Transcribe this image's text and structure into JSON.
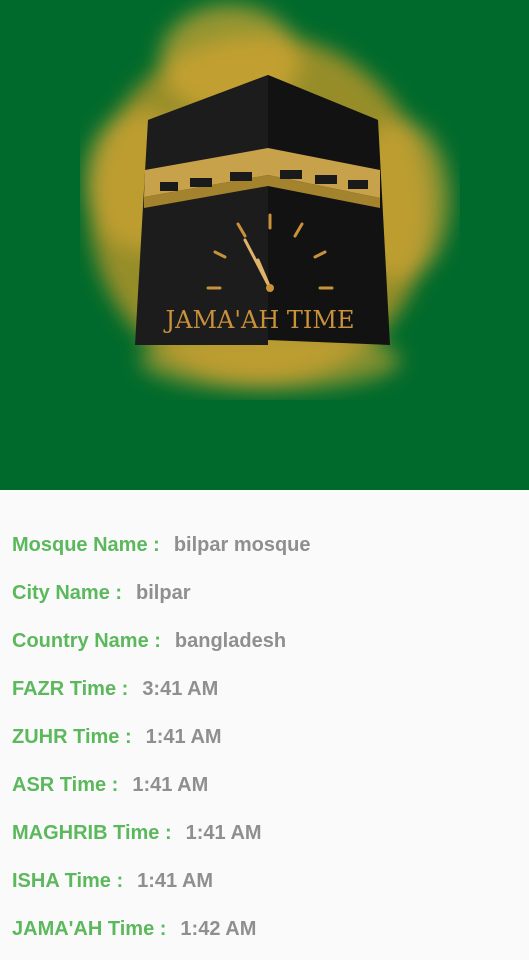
{
  "logo": {
    "text": "JAMA'AH TIME",
    "colors": {
      "background": "#006a2c",
      "glow": "#d8a52a",
      "cube": "#1a1a1a",
      "band": "#c8a24a",
      "logo_text": "#c9913a"
    }
  },
  "info": {
    "rows": [
      {
        "label": "Mosque Name :",
        "value": "bilpar mosque"
      },
      {
        "label": "City Name :",
        "value": "bilpar"
      },
      {
        "label": "Country Name :",
        "value": "bangladesh"
      },
      {
        "label": "FAZR Time :",
        "value": "3:41 AM"
      },
      {
        "label": "ZUHR Time :",
        "value": "1:41 AM"
      },
      {
        "label": "ASR Time :",
        "value": "1:41 AM"
      },
      {
        "label": "MAGHRIB Time :",
        "value": "1:41 AM"
      },
      {
        "label": "ISHA Time :",
        "value": "1:41 AM"
      },
      {
        "label": "JAMA'AH Time :",
        "value": "1:42 AM"
      }
    ],
    "colors": {
      "label": "#5cb85c",
      "value": "#8f8f8f"
    }
  }
}
